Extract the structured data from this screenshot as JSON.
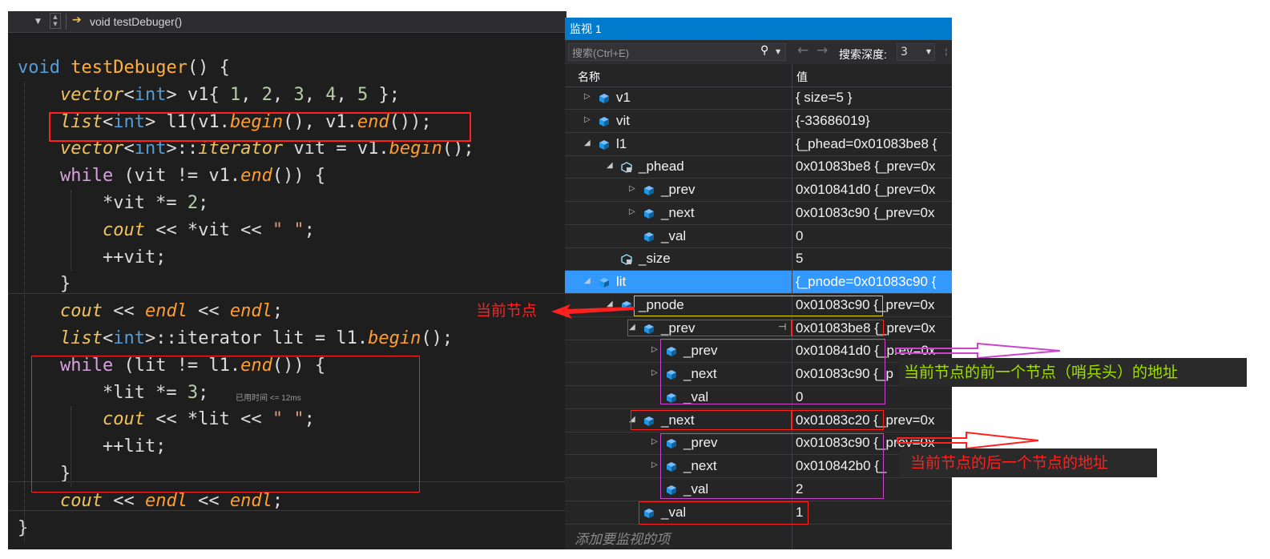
{
  "editor": {
    "nav_function": "void testDebuger()",
    "code_lines": [
      [
        {
          "t": "void ",
          "c": "kw"
        },
        {
          "t": "testDebuger",
          "c": "fnc"
        },
        {
          "t": "() {",
          "c": "tp"
        }
      ],
      [
        {
          "t": "    ",
          "c": "tp"
        },
        {
          "t": "vector",
          "c": "it"
        },
        {
          "t": "<",
          "c": "tp"
        },
        {
          "t": "int",
          "c": "kw"
        },
        {
          "t": "> v1{ ",
          "c": "tp"
        },
        {
          "t": "1",
          "c": "num"
        },
        {
          "t": ", ",
          "c": "tp"
        },
        {
          "t": "2",
          "c": "num"
        },
        {
          "t": ", ",
          "c": "tp"
        },
        {
          "t": "3",
          "c": "num"
        },
        {
          "t": ", ",
          "c": "tp"
        },
        {
          "t": "4",
          "c": "num"
        },
        {
          "t": ", ",
          "c": "tp"
        },
        {
          "t": "5",
          "c": "num"
        },
        {
          "t": " };",
          "c": "tp"
        }
      ],
      [
        {
          "t": "    ",
          "c": "tp"
        },
        {
          "t": "list",
          "c": "it"
        },
        {
          "t": "<",
          "c": "tp"
        },
        {
          "t": "int",
          "c": "kw"
        },
        {
          "t": "> l1(v1.",
          "c": "tp"
        },
        {
          "t": "begin",
          "c": "itg"
        },
        {
          "t": "(), v1.",
          "c": "tp"
        },
        {
          "t": "end",
          "c": "itg"
        },
        {
          "t": "());",
          "c": "tp"
        }
      ],
      [
        {
          "t": "    ",
          "c": "tp"
        },
        {
          "t": "vector",
          "c": "it"
        },
        {
          "t": "<",
          "c": "tp"
        },
        {
          "t": "int",
          "c": "kw"
        },
        {
          "t": ">::",
          "c": "tp"
        },
        {
          "t": "iterator",
          "c": "it"
        },
        {
          "t": " vit = v1.",
          "c": "tp"
        },
        {
          "t": "begin",
          "c": "itg"
        },
        {
          "t": "();",
          "c": "tp"
        }
      ],
      [
        {
          "t": "    ",
          "c": "tp"
        },
        {
          "t": "while",
          "c": "kw2"
        },
        {
          "t": " (vit != v1.",
          "c": "tp"
        },
        {
          "t": "end",
          "c": "itg"
        },
        {
          "t": "()) {",
          "c": "tp"
        }
      ],
      [
        {
          "t": "        *vit *= ",
          "c": "tp"
        },
        {
          "t": "2",
          "c": "num"
        },
        {
          "t": ";",
          "c": "tp"
        }
      ],
      [
        {
          "t": "        ",
          "c": "tp"
        },
        {
          "t": "cout",
          "c": "it"
        },
        {
          "t": " << *vit << ",
          "c": "tp"
        },
        {
          "t": "\" \"",
          "c": "str"
        },
        {
          "t": ";",
          "c": "tp"
        }
      ],
      [
        {
          "t": "        ++vit;",
          "c": "tp"
        }
      ],
      [
        {
          "t": "    }",
          "c": "tp"
        }
      ],
      [
        {
          "t": "    ",
          "c": "tp"
        },
        {
          "t": "cout",
          "c": "it"
        },
        {
          "t": " << ",
          "c": "tp"
        },
        {
          "t": "endl",
          "c": "itg"
        },
        {
          "t": " << ",
          "c": "tp"
        },
        {
          "t": "endl",
          "c": "itg"
        },
        {
          "t": ";",
          "c": "tp"
        }
      ],
      [
        {
          "t": "    ",
          "c": "tp"
        },
        {
          "t": "list",
          "c": "it"
        },
        {
          "t": "<",
          "c": "tp"
        },
        {
          "t": "int",
          "c": "kw"
        },
        {
          "t": ">::iterator lit = l1.",
          "c": "tp"
        },
        {
          "t": "begin",
          "c": "itg"
        },
        {
          "t": "();",
          "c": "tp"
        }
      ],
      [
        {
          "t": "    ",
          "c": "tp"
        },
        {
          "t": "while",
          "c": "kw2"
        },
        {
          "t": " (lit != l1.",
          "c": "tp"
        },
        {
          "t": "end",
          "c": "itg"
        },
        {
          "t": "()) {",
          "c": "tp"
        }
      ],
      [
        {
          "t": "        *lit *= ",
          "c": "tp"
        },
        {
          "t": "3",
          "c": "num"
        },
        {
          "t": ";",
          "c": "tp"
        }
      ],
      [
        {
          "t": "        ",
          "c": "tp"
        },
        {
          "t": "cout",
          "c": "it"
        },
        {
          "t": " << *lit << ",
          "c": "tp"
        },
        {
          "t": "\" \"",
          "c": "str"
        },
        {
          "t": ";",
          "c": "tp"
        }
      ],
      [
        {
          "t": "        ++lit;",
          "c": "tp"
        }
      ],
      [
        {
          "t": "    }",
          "c": "tp"
        }
      ],
      [
        {
          "t": "    ",
          "c": "tp"
        },
        {
          "t": "cout",
          "c": "it"
        },
        {
          "t": " << ",
          "c": "tp"
        },
        {
          "t": "endl",
          "c": "itg"
        },
        {
          "t": " << ",
          "c": "tp"
        },
        {
          "t": "endl",
          "c": "itg"
        },
        {
          "t": ";",
          "c": "tp"
        }
      ],
      [
        {
          "t": "}",
          "c": "tp"
        }
      ]
    ],
    "perf_hint": "已用时间 <= 12ms"
  },
  "watch": {
    "title": "监视 1",
    "search_placeholder": "搜索(Ctrl+E)",
    "depth_label": "搜索深度:",
    "depth_value": "3",
    "col_name": "名称",
    "col_value": "值",
    "rows": [
      {
        "name": "v1",
        "value": "{ size=5 }",
        "expander": "collapsed",
        "icon": "field-icon",
        "depth": 0
      },
      {
        "name": "vit",
        "value": "{-33686019}",
        "expander": "collapsed",
        "icon": "field-icon",
        "depth": 0
      },
      {
        "name": "l1",
        "value": "{_phead=0x01083be8 {",
        "expander": "expanded",
        "icon": "field-icon",
        "depth": 0
      },
      {
        "name": "_phead",
        "value": "0x01083be8 {_prev=0x",
        "expander": "expanded",
        "icon": "private-field-icon",
        "depth": 1
      },
      {
        "name": "_prev",
        "value": "0x010841d0 {_prev=0x",
        "expander": "collapsed",
        "icon": "field-icon",
        "depth": 2
      },
      {
        "name": "_next",
        "value": "0x01083c90 {_prev=0x",
        "expander": "collapsed",
        "icon": "field-icon",
        "depth": 2
      },
      {
        "name": "_val",
        "value": "0",
        "expander": "none",
        "icon": "field-icon",
        "depth": 2
      },
      {
        "name": "_size",
        "value": "5",
        "expander": "none",
        "icon": "private-field-icon",
        "depth": 1
      },
      {
        "name": "lit",
        "value": "{_pnode=0x01083c90 {",
        "expander": "expanded",
        "icon": "field-icon",
        "depth": 0,
        "selected": true
      },
      {
        "name": "_pnode",
        "value": "0x01083c90 {_prev=0x",
        "expander": "expanded",
        "icon": "field-icon",
        "depth": 1
      },
      {
        "name": "_prev",
        "value": "0x01083be8 {_prev=0x",
        "expander": "expanded",
        "icon": "field-icon",
        "depth": 2,
        "pin": true
      },
      {
        "name": "_prev",
        "value": "0x010841d0 {_prev=0x",
        "expander": "collapsed",
        "icon": "field-icon",
        "depth": 3
      },
      {
        "name": "_next",
        "value": "0x01083c90 {_p",
        "expander": "collapsed",
        "icon": "field-icon",
        "depth": 3
      },
      {
        "name": "_val",
        "value": "0",
        "expander": "none",
        "icon": "field-icon",
        "depth": 3
      },
      {
        "name": "_next",
        "value": "0x01083c20 {_prev=0x",
        "expander": "expanded",
        "icon": "field-icon",
        "depth": 2
      },
      {
        "name": "_prev",
        "value": "0x01083c90 {_prev=0x",
        "expander": "collapsed",
        "icon": "field-icon",
        "depth": 3
      },
      {
        "name": "_next",
        "value": "0x010842b0 {_",
        "expander": "collapsed",
        "icon": "field-icon",
        "depth": 3
      },
      {
        "name": "_val",
        "value": "2",
        "expander": "none",
        "icon": "field-icon",
        "depth": 3
      },
      {
        "name": "_val",
        "value": "1",
        "expander": "none",
        "icon": "field-icon",
        "depth": 2
      }
    ],
    "add_placeholder": "添加要监视的项"
  },
  "annotations": {
    "current_node": "当前节点",
    "prev_node_address": "当前节点的前一个节点（哨兵头）的地址",
    "next_node_address": "当前节点的后一个节点的地址"
  },
  "colors": {
    "annotation_red": "#ff2020",
    "annotation_green": "#a0e000",
    "annotation_magenta": "#cc44cc",
    "selection_blue": "#3399ff",
    "title_blue": "#007acc"
  }
}
